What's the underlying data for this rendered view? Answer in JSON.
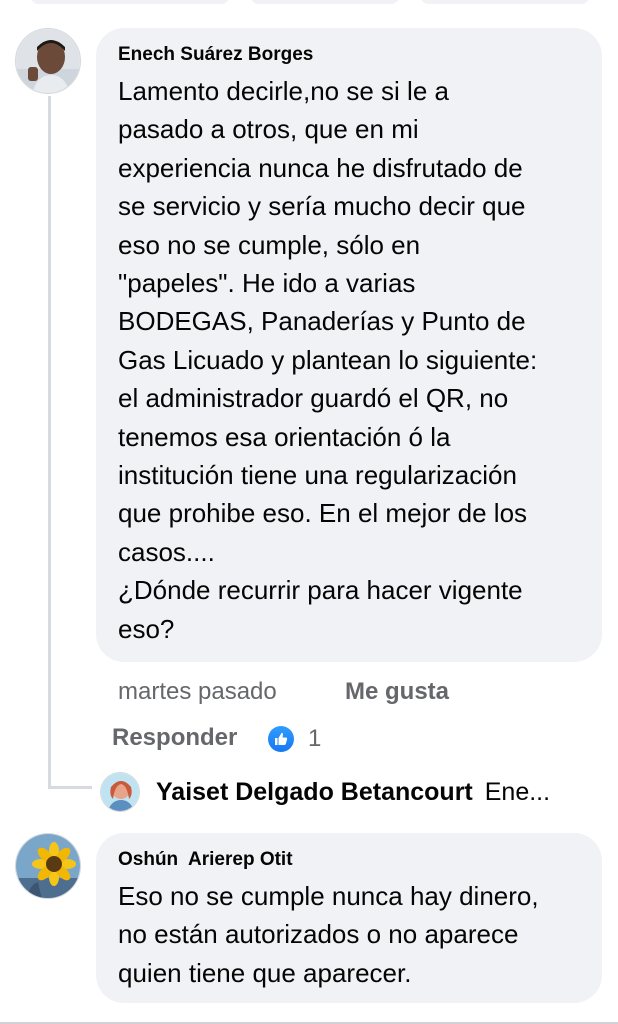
{
  "comments": [
    {
      "author": "Enech Suárez Borges",
      "text": "Lamento decirle,no se si le a\npasado a otros, que en mi\nexperiencia nunca he disfrutado de\nse servicio y sería mucho decir que\neso no se cumple, sólo en\n\"papeles\". He ido a varias\nBODEGAS, Panaderías y Punto de\nGas Licuado y plantean lo siguiente:\nel administrador guardó el QR, no\ntenemos esa orientación ó la\ninstitución tiene una regularización\nque prohibe eso. En el mejor de los\ncasos....\n¿Dónde recurrir para hacer vigente\neso?",
      "time": "martes pasado",
      "like_label": "Me gusta",
      "reply_label": "Responder",
      "reaction_count": "1",
      "reaction_icon": "like-thumb-icon"
    },
    {
      "author": "Oshún  Arierep Otit",
      "text": "Eso no se cumple nunca hay dinero,\nno están autorizados o no aparece\nquien tiene que aparecer."
    }
  ],
  "reply_preview": {
    "name": "Yaiset Delgado Betancourt",
    "snippet": "Ene..."
  },
  "colors": {
    "bubble": "#f0f2f5",
    "meta_text": "#65676b",
    "like_blue": "#1877f2"
  }
}
